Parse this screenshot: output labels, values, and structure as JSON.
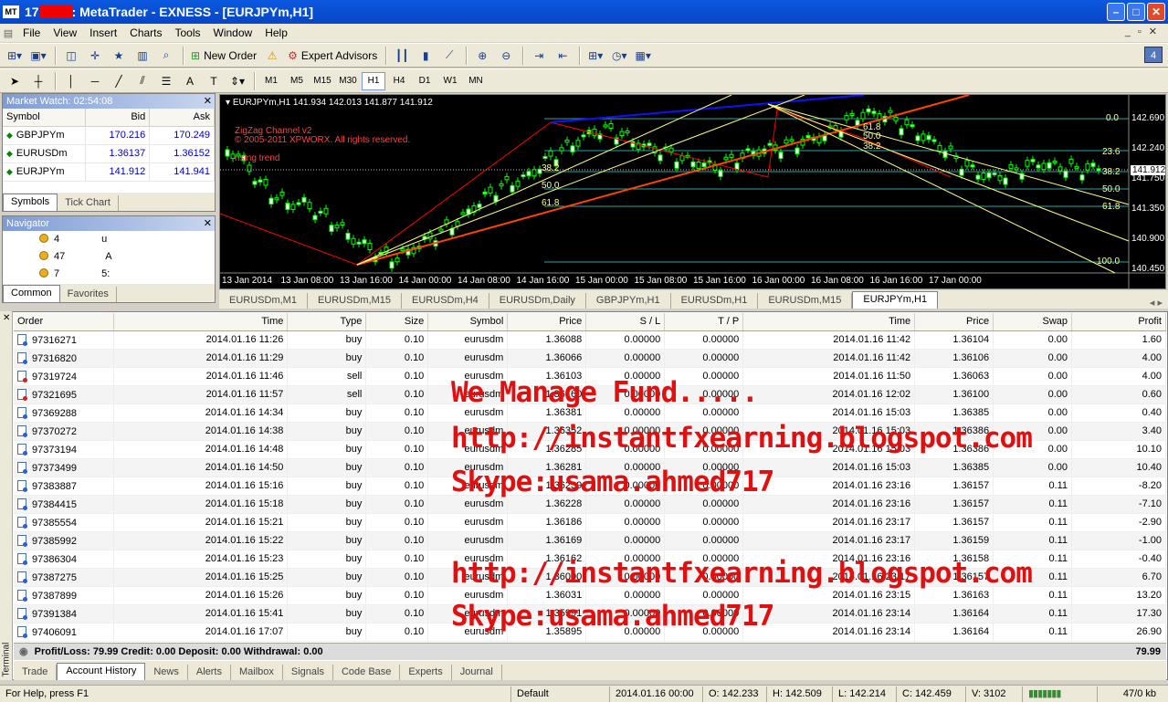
{
  "window": {
    "title_prefix": "17",
    "title_main": ": MetaTrader - EXNESS - [EURJPYm,H1]",
    "app_icon": "MT"
  },
  "menu": [
    "File",
    "View",
    "Insert",
    "Charts",
    "Tools",
    "Window",
    "Help"
  ],
  "toolbar": {
    "new_order": "New Order",
    "expert_advisors": "Expert Advisors"
  },
  "timeframes": [
    "M1",
    "M5",
    "M15",
    "M30",
    "H1",
    "H4",
    "D1",
    "W1",
    "MN"
  ],
  "active_timeframe": "H1",
  "notifications": "4",
  "market_watch": {
    "title": "Market Watch: 02:54:08",
    "headers": {
      "symbol": "Symbol",
      "bid": "Bid",
      "ask": "Ask"
    },
    "rows": [
      {
        "symbol": "GBPJPYm",
        "bid": "170.216",
        "ask": "170.249"
      },
      {
        "symbol": "EURUSDm",
        "bid": "1.36137",
        "ask": "1.36152"
      },
      {
        "symbol": "EURJPYm",
        "bid": "141.912",
        "ask": "141.941"
      }
    ],
    "tabs": [
      "Symbols",
      "Tick Chart"
    ]
  },
  "navigator": {
    "title": "Navigator",
    "items": [
      "4",
      "47",
      "7"
    ],
    "item_tails": [
      "u",
      "A",
      "5:"
    ],
    "tabs": [
      "Common",
      "Favorites"
    ]
  },
  "chart": {
    "header": "EURJPYm,H1  141.934 142.013 141.877 141.912",
    "indicator_name": "ZigZag Channel v2",
    "indicator_copyright": "© 2005-2011 XPWORX. All rights reserved.",
    "trend_label": "rising trend",
    "price_labels": [
      "142.690",
      "142.240",
      "141.750",
      "141.350",
      "140.900",
      "140.450"
    ],
    "current_price": "141.912",
    "fib_right": [
      "0.0",
      "23.6",
      "38.2",
      "50.0",
      "61.8",
      "100.0"
    ],
    "fib_left": [
      "38.2",
      "50.0",
      "61.8"
    ],
    "fib_top": [
      "61.8",
      "50.0",
      "38.2"
    ],
    "time_labels": [
      "13 Jan 2014",
      "13 Jan 08:00",
      "13 Jan 16:00",
      "14 Jan 00:00",
      "14 Jan 08:00",
      "14 Jan 16:00",
      "15 Jan 00:00",
      "15 Jan 08:00",
      "15 Jan 16:00",
      "16 Jan 00:00",
      "16 Jan 08:00",
      "16 Jan 16:00",
      "17 Jan 00:00"
    ]
  },
  "chart_tabs": [
    "EURUSDm,M1",
    "EURUSDm,M15",
    "EURUSDm,H4",
    "EURUSDm,Daily",
    "GBPJPYm,H1",
    "EURUSDm,H1",
    "EURUSDm,M15",
    "EURJPYm,H1"
  ],
  "active_chart_tab": "EURJPYm,H1",
  "terminal": {
    "side_label": "Terminal",
    "columns": [
      "Order",
      "Time",
      "Type",
      "Size",
      "Symbol",
      "Price",
      "S / L",
      "T / P",
      "Time",
      "Price",
      "Swap",
      "Profit"
    ],
    "rows": [
      [
        "97316271",
        "2014.01.16 11:26",
        "buy",
        "0.10",
        "eurusdm",
        "1.36088",
        "0.00000",
        "0.00000",
        "2014.01.16 11:42",
        "1.36104",
        "0.00",
        "1.60"
      ],
      [
        "97316820",
        "2014.01.16 11:29",
        "buy",
        "0.10",
        "eurusdm",
        "1.36066",
        "0.00000",
        "0.00000",
        "2014.01.16 11:42",
        "1.36106",
        "0.00",
        "4.00"
      ],
      [
        "97319724",
        "2014.01.16 11:46",
        "sell",
        "0.10",
        "eurusdm",
        "1.36103",
        "0.00000",
        "0.00000",
        "2014.01.16 11:50",
        "1.36063",
        "0.00",
        "4.00"
      ],
      [
        "97321695",
        "2014.01.16 11:57",
        "sell",
        "0.10",
        "eurusdm",
        "1.36160",
        "0.00000",
        "0.00000",
        "2014.01.16 12:02",
        "1.36100",
        "0.00",
        "0.60"
      ],
      [
        "97369288",
        "2014.01.16 14:34",
        "buy",
        "0.10",
        "eurusdm",
        "1.36381",
        "0.00000",
        "0.00000",
        "2014.01.16 15:03",
        "1.36385",
        "0.00",
        "0.40"
      ],
      [
        "97370272",
        "2014.01.16 14:38",
        "buy",
        "0.10",
        "eurusdm",
        "1.36352",
        "0.00000",
        "0.00000",
        "2014.01.16 15:03",
        "1.36386",
        "0.00",
        "3.40"
      ],
      [
        "97373194",
        "2014.01.16 14:48",
        "buy",
        "0.10",
        "eurusdm",
        "1.36285",
        "0.00000",
        "0.00000",
        "2014.01.16 15:03",
        "1.36386",
        "0.00",
        "10.10"
      ],
      [
        "97373499",
        "2014.01.16 14:50",
        "buy",
        "0.10",
        "eurusdm",
        "1.36281",
        "0.00000",
        "0.00000",
        "2014.01.16 15:03",
        "1.36385",
        "0.00",
        "10.40"
      ],
      [
        "97383887",
        "2014.01.16 15:16",
        "buy",
        "0.10",
        "eurusdm",
        "1.36239",
        "0.00000",
        "0.00000",
        "2014.01.16 23:16",
        "1.36157",
        "0.11",
        "-8.20"
      ],
      [
        "97384415",
        "2014.01.16 15:18",
        "buy",
        "0.10",
        "eurusdm",
        "1.36228",
        "0.00000",
        "0.00000",
        "2014.01.16 23:16",
        "1.36157",
        "0.11",
        "-7.10"
      ],
      [
        "97385554",
        "2014.01.16 15:21",
        "buy",
        "0.10",
        "eurusdm",
        "1.36186",
        "0.00000",
        "0.00000",
        "2014.01.16 23:17",
        "1.36157",
        "0.11",
        "-2.90"
      ],
      [
        "97385992",
        "2014.01.16 15:22",
        "buy",
        "0.10",
        "eurusdm",
        "1.36169",
        "0.00000",
        "0.00000",
        "2014.01.16 23:17",
        "1.36159",
        "0.11",
        "-1.00"
      ],
      [
        "97386304",
        "2014.01.16 15:23",
        "buy",
        "0.10",
        "eurusdm",
        "1.36162",
        "0.00000",
        "0.00000",
        "2014.01.16 23:16",
        "1.36158",
        "0.11",
        "-0.40"
      ],
      [
        "97387275",
        "2014.01.16 15:25",
        "buy",
        "0.10",
        "eurusdm",
        "1.36090",
        "0.00000",
        "0.00000",
        "2014.01.16 23:17",
        "1.36157",
        "0.11",
        "6.70"
      ],
      [
        "97387899",
        "2014.01.16 15:26",
        "buy",
        "0.10",
        "eurusdm",
        "1.36031",
        "0.00000",
        "0.00000",
        "2014.01.16 23:15",
        "1.36163",
        "0.11",
        "13.20"
      ],
      [
        "97391384",
        "2014.01.16 15:41",
        "buy",
        "0.10",
        "eurusdm",
        "1.35991",
        "0.00000",
        "0.00000",
        "2014.01.16 23:14",
        "1.36164",
        "0.11",
        "17.30"
      ],
      [
        "97406091",
        "2014.01.16 17:07",
        "buy",
        "0.10",
        "eurusdm",
        "1.35895",
        "0.00000",
        "0.00000",
        "2014.01.16 23:14",
        "1.36164",
        "0.11",
        "26.90"
      ]
    ],
    "summary": "Profit/Loss: 79.99  Credit: 0.00  Deposit: 0.00  Withdrawal: 0.00",
    "summary_total": "79.99",
    "tabs": [
      "Trade",
      "Account History",
      "News",
      "Alerts",
      "Mailbox",
      "Signals",
      "Code Base",
      "Experts",
      "Journal"
    ],
    "active_tab": "Account History"
  },
  "overlay": {
    "line1": "We Manage Fund.....",
    "line2": "http://instantfxearning.blogspot.com",
    "line3": "Skype:usama.ahmed717",
    "line4": "http://instantfxearning.blogspot.com",
    "line5": "Skype:usama.ahmed717"
  },
  "status": {
    "help": "For Help, press F1",
    "profile": "Default",
    "datetime": "2014.01.16 00:00",
    "open": "O: 142.233",
    "high": "H: 142.509",
    "low": "L: 142.214",
    "close": "C: 142.459",
    "volume": "V: 3102",
    "traffic": "47/0 kb"
  },
  "colors": {
    "chart_bg": "#000000",
    "bull_candle": "#00ff00",
    "zigzag": "#ff0000",
    "channel_upper": "#0000ff",
    "channel_lower": "#ff4500",
    "fib": "#ffff80",
    "overlay_text": "#e01010"
  }
}
